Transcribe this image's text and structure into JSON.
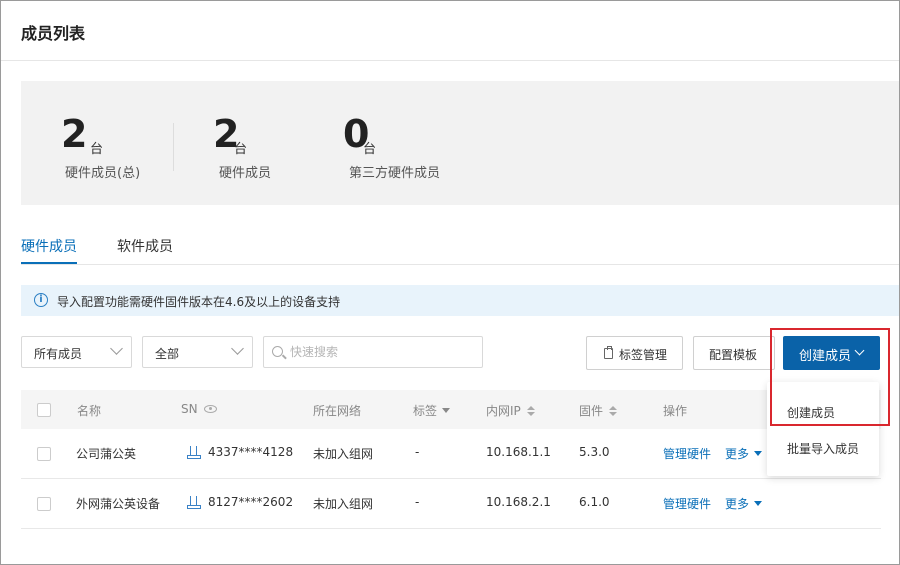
{
  "page": {
    "title": "成员列表"
  },
  "stats": [
    {
      "value": "2",
      "unit": "台",
      "label": "硬件成员(总)"
    },
    {
      "value": "2",
      "unit": "台",
      "label": "硬件成员"
    },
    {
      "value": "0",
      "unit": "台",
      "label": "第三方硬件成员"
    }
  ],
  "tabs": [
    {
      "label": "硬件成员",
      "active": true
    },
    {
      "label": "软件成员",
      "active": false
    }
  ],
  "notice": {
    "icon": "info-icon",
    "text": "导入配置功能需硬件固件版本在4.6及以上的设备支持"
  },
  "filters": {
    "member_select": "所有成员",
    "scope_select": "全部",
    "search_placeholder": "快速搜索"
  },
  "toolbar": {
    "tag_manage": "标签管理",
    "config_template": "配置模板",
    "create_member": "创建成员"
  },
  "dropdown": {
    "items": [
      "创建成员",
      "批量导入成员"
    ]
  },
  "table": {
    "columns": {
      "name": "名称",
      "sn": "SN",
      "network": "所在网络",
      "tag": "标签",
      "ip": "内网IP",
      "firmware": "固件",
      "actions": "操作"
    },
    "rows": [
      {
        "name": "公司蒲公英",
        "sn": "4337****4128",
        "network": "未加入组网",
        "tag": "-",
        "ip": "10.168.1.1",
        "firmware": "5.3.0",
        "manage": "管理硬件",
        "more": "更多"
      },
      {
        "name": "外网蒲公英设备",
        "sn": "8127****2602",
        "network": "未加入组网",
        "tag": "-",
        "ip": "10.168.2.1",
        "firmware": "6.1.0",
        "manage": "管理硬件",
        "more": "更多"
      }
    ]
  },
  "colors": {
    "primary": "#0a62a8",
    "link": "#0a6fb8",
    "highlight": "#d9272e",
    "notice_bg": "#e8f3fb"
  }
}
